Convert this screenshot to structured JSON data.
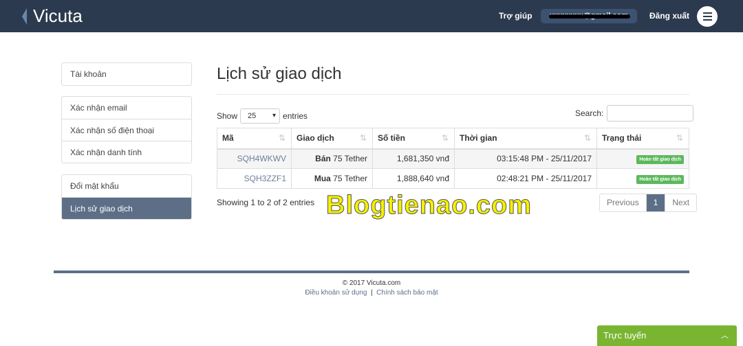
{
  "nav": {
    "logo": "Vicuta",
    "help": "Trợ giúp",
    "email": "xxxxxxxx@gmail.com",
    "logout": "Đăng xuất"
  },
  "sidebar": {
    "groups": [
      [
        "Tài khoản"
      ],
      [
        "Xác nhận email",
        "Xác nhận số điện thoại",
        "Xác nhận danh tính"
      ],
      [
        "Đổi mật khẩu",
        "Lịch sử giao dịch"
      ]
    ]
  },
  "main": {
    "title": "Lịch sử giao dịch",
    "show": "Show",
    "entries_value": "25",
    "entries": "entries",
    "search": "Search:",
    "columns": [
      "Mã",
      "Giao dịch",
      "Số tiền",
      "Thời gian",
      "Trạng thái"
    ],
    "rows": [
      {
        "code": "SQH4WKWV",
        "type": "Bán",
        "item": "75 Tether",
        "amount": "1,681,350 vnđ",
        "time": "03:15:48 PM - 25/11/2017",
        "status": "Hoàn tất giao dịch"
      },
      {
        "code": "SQH3ZZF1",
        "type": "Mua",
        "item": "75 Tether",
        "amount": "1,888,640 vnđ",
        "time": "02:48:21 PM - 25/11/2017",
        "status": "Hoàn tất giao dịch"
      }
    ],
    "info": "Showing 1 to 2 of 2 entries",
    "prev": "Previous",
    "page": "1",
    "next": "Next"
  },
  "watermark": "Blogtienao.com",
  "footer": {
    "copyright": "© 2017 Vicuta.com",
    "terms": "Điều khoản sử dụng",
    "sep": "|",
    "privacy": "Chính sách bảo mật"
  },
  "chat": {
    "label": "Trực tuyến"
  },
  "colors": {
    "nav": "#2c3a4f",
    "accent": "#5d6f87",
    "success": "#5cb85c",
    "chat": "#79b531"
  }
}
